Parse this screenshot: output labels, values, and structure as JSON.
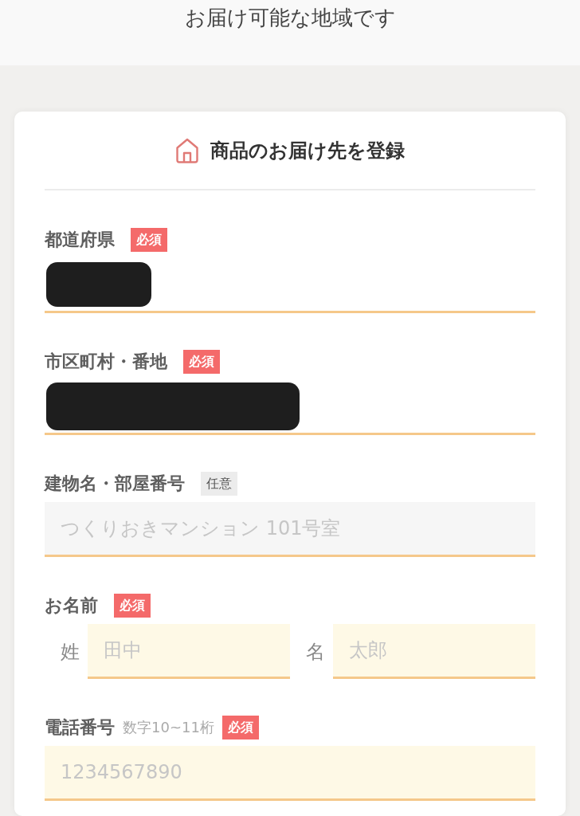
{
  "header": {
    "text": "お届け可能な地域です"
  },
  "card": {
    "title": "商品のお届け先を登録",
    "fields": [
      {
        "kind": "text",
        "label": "都道府県",
        "badge": {
          "text": "必須",
          "required": true
        },
        "redaction": {
          "kind": "short"
        }
      },
      {
        "kind": "text",
        "label": "市区町村・番地",
        "badge": {
          "text": "必須",
          "required": true
        },
        "redaction": {
          "kind": "long"
        }
      },
      {
        "kind": "text",
        "label": "建物名・部屋番号",
        "badge": {
          "text": "任意",
          "required": false
        },
        "placeholder": "つくりおきマンション 101号室"
      },
      {
        "kind": "name",
        "label": "お名前",
        "badge": {
          "text": "必須",
          "required": true
        },
        "parts": [
          {
            "label": "姓",
            "placeholder": "田中"
          },
          {
            "label": "名",
            "placeholder": "太郎"
          }
        ]
      },
      {
        "kind": "text",
        "label": "電話番号",
        "hint": "数字10~11桁",
        "badge": {
          "text": "必須",
          "required": true
        },
        "placeholder": "1234567890"
      }
    ]
  }
}
